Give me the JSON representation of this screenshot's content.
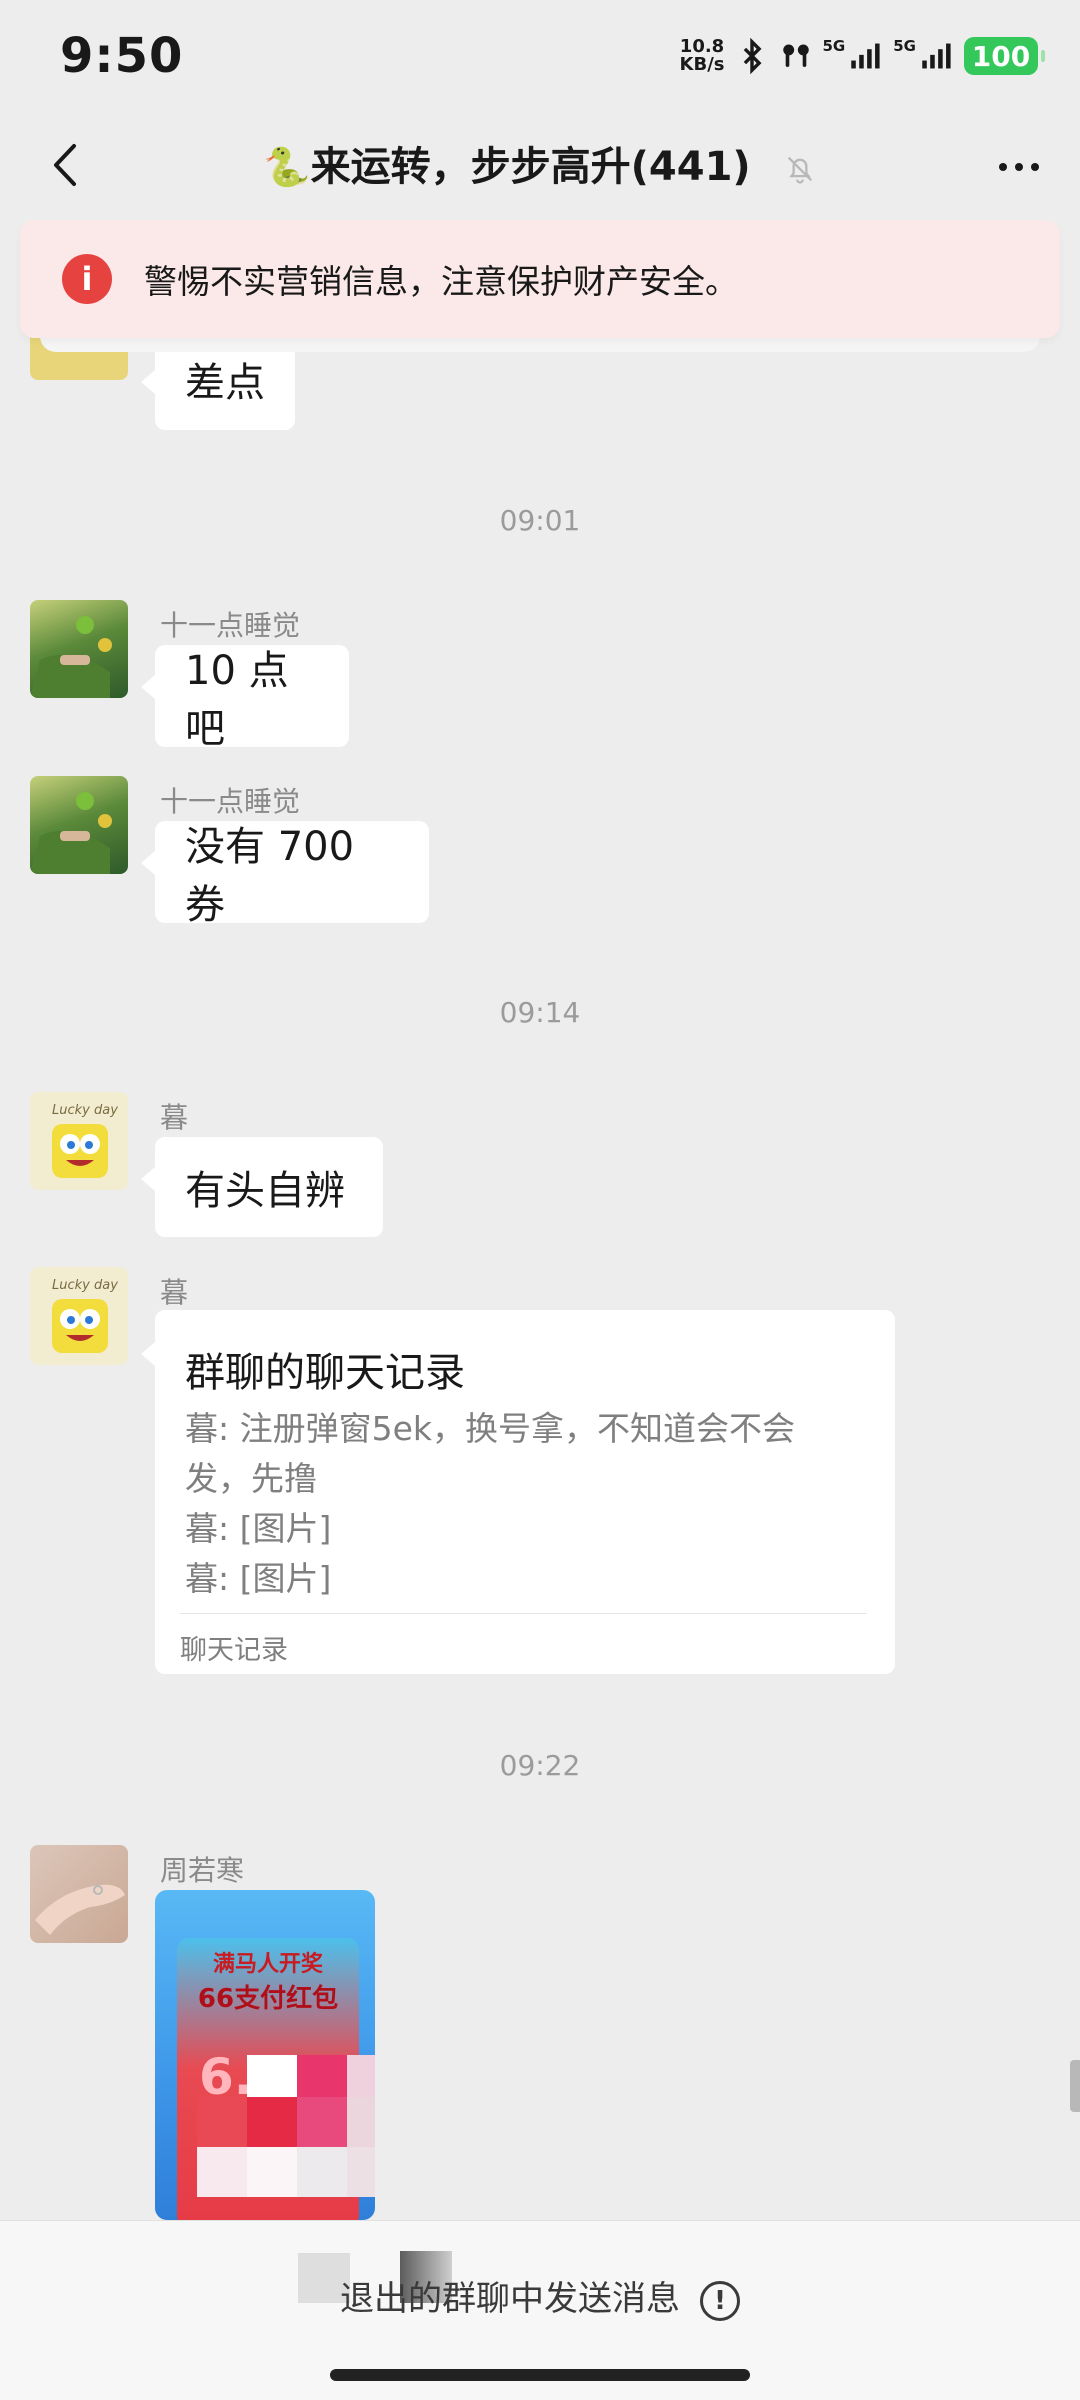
{
  "status_bar": {
    "time": "9:50",
    "net_speed_value": "10.8",
    "net_speed_unit": "KB/s",
    "sig_label_1": "5G",
    "sig_label_2": "5G",
    "battery": "100"
  },
  "nav": {
    "title": "来运转，步步高升(441)",
    "title_emoji": "🐍"
  },
  "warning": {
    "text": "警惕不实营销信息，注意保护财产安全。",
    "icon": "i"
  },
  "chat": {
    "partial_message": "差点",
    "time_1": "09:01",
    "msg_1": {
      "sender": "十一点睡觉",
      "text": "10 点吧"
    },
    "msg_2": {
      "sender": "十一点睡觉",
      "text": "没有 700 券"
    },
    "time_2": "09:14",
    "msg_3": {
      "sender": "暮",
      "text": "有头自辨"
    },
    "msg_4": {
      "sender": "暮",
      "record_title": "群聊的聊天记录",
      "lines": [
        "暮: 注册弹窗5ek，换号拿，不知道会不会发，先撸",
        "暮: [图片]",
        "暮: [图片]"
      ],
      "footer": "聊天记录"
    },
    "time_3": "09:22",
    "msg_5": {
      "sender": "周若寒",
      "packet_top": "满马人开奖",
      "packet_title": "66支付红包",
      "packet_number": "6.6"
    }
  },
  "bottom": {
    "exit_text": "退出的群聊中发送消息",
    "info_icon": "!"
  }
}
